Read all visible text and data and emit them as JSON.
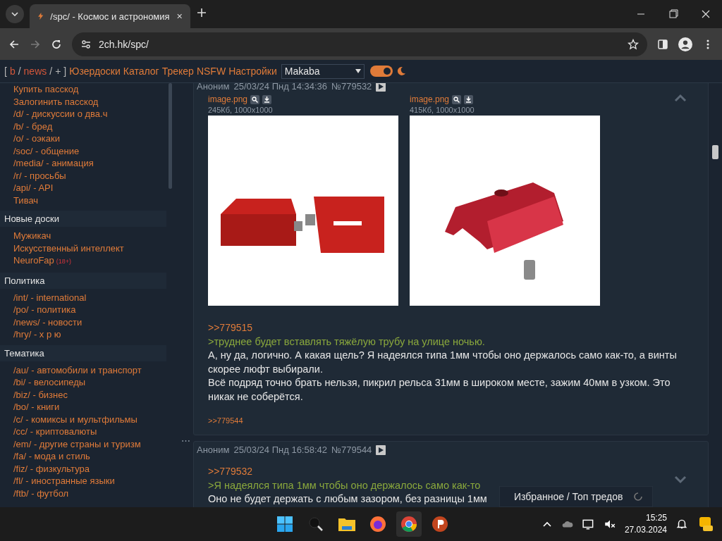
{
  "browser": {
    "tab_title": "/spc/ - Космос и астрономия",
    "url": "2ch.hk/spc/"
  },
  "nav": {
    "items": [
      {
        "kind": "punct",
        "text": "["
      },
      {
        "kind": "board",
        "text": "b"
      },
      {
        "kind": "punct",
        "text": "/"
      },
      {
        "kind": "board",
        "text": "news"
      },
      {
        "kind": "punct",
        "text": "/"
      },
      {
        "kind": "punct",
        "text": "+"
      },
      {
        "kind": "punct",
        "text": "]"
      },
      {
        "kind": "link",
        "text": "Юзердоски"
      },
      {
        "kind": "link",
        "text": "Каталог"
      },
      {
        "kind": "link",
        "text": "Трекер"
      },
      {
        "kind": "link",
        "text": "NSFW"
      },
      {
        "kind": "link",
        "text": "Настройки"
      }
    ],
    "style_select": "Makaba",
    "dark_theme": true
  },
  "sidebar": {
    "sections": [
      {
        "items": [
          {
            "text": "Купить пасскод"
          },
          {
            "text": "Залогинить пасскод"
          },
          {
            "text": "/d/ - дискуссии о два.ч"
          },
          {
            "text": "/b/ - бред"
          },
          {
            "text": "/o/ - оэкаки"
          },
          {
            "text": "/soc/ - общение"
          },
          {
            "text": "/media/ - анимация"
          },
          {
            "text": "/r/ - просьбы"
          },
          {
            "text": "/api/ - API"
          },
          {
            "text": "Тивач"
          }
        ]
      },
      {
        "title": "Новые доски",
        "items": [
          {
            "text": "Мужикач"
          },
          {
            "text": "Искусственный интеллект"
          },
          {
            "text": "NeuroFap",
            "badge": "(18+)"
          }
        ]
      },
      {
        "title": "Политика",
        "items": [
          {
            "text": "/int/ - international"
          },
          {
            "text": "/po/ - политика"
          },
          {
            "text": "/news/ - новости"
          },
          {
            "text": "/hry/ - х р ю"
          }
        ]
      },
      {
        "title": "Тематика",
        "items": [
          {
            "text": "/au/ - автомобили и транспорт"
          },
          {
            "text": "/bi/ - велосипеды"
          },
          {
            "text": "/biz/ - бизнес"
          },
          {
            "text": "/bo/ - книги"
          },
          {
            "text": "/c/ - комиксы и мультфильмы"
          },
          {
            "text": "/cc/ - криптовалюты"
          },
          {
            "text": "/em/ - другие страны и туризм"
          },
          {
            "text": "/fa/ - мода и стиль"
          },
          {
            "text": "/fiz/ - физкультура"
          },
          {
            "text": "/fl/ - иностранные языки"
          },
          {
            "text": "/ftb/ - футбол"
          }
        ]
      }
    ]
  },
  "posts": [
    {
      "name": "Аноним",
      "date": "25/03/24 Пнд 14:34:36",
      "number": "№779532",
      "files": [
        {
          "name": "image.png",
          "info": "245Кб, 1000x1000"
        },
        {
          "name": "image.png",
          "info": "415Кб, 1000x1000"
        }
      ],
      "body": [
        {
          "kind": "reply",
          "text": ">>779515"
        },
        {
          "kind": "quote",
          "text": ">труднее будет вставлять тяжёлую трубу на улице ночью."
        },
        {
          "kind": "text",
          "text": "А, ну да, логично. А какая щель? Я надеялся типа 1мм чтобы оно держалось само как-то, а винты скорее люфт выбирали."
        },
        {
          "kind": "text",
          "text": "Всё подряд точно брать нельзя, пикрил рельса 31мм в широком месте, зажим 40мм в узком. Это никак не соберётся."
        }
      ],
      "replies": [
        ">>779544"
      ]
    },
    {
      "name": "Аноним",
      "date": "25/03/24 Пнд 16:58:42",
      "number": "№779544",
      "body": [
        {
          "kind": "reply",
          "text": ">>779532"
        },
        {
          "kind": "quote",
          "text": ">Я надеялся типа 1мм чтобы оно держалось само как-то"
        },
        {
          "kind": "text",
          "text": "Оно не будет держать с любым зазором, без разницы 1мм"
        }
      ]
    }
  ],
  "collapse_mark": "⋯",
  "floating_panel": "Избранное / Топ тредов",
  "taskbar": {
    "time": "15:25",
    "date": "27.03.2024"
  }
}
